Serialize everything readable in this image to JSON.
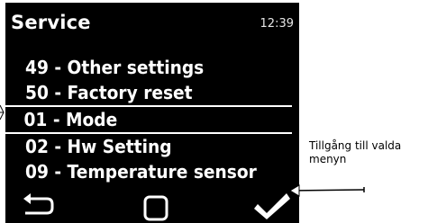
{
  "screen": {
    "title": "Service",
    "time": "12:39"
  },
  "menu": {
    "items": [
      {
        "label": "49 - Other settings",
        "selected": false
      },
      {
        "label": "50 - Factory reset",
        "selected": false
      },
      {
        "label": "01 - Mode",
        "selected": true
      },
      {
        "label": "02 - Hw Setting",
        "selected": false
      },
      {
        "label": "09 - Temperature sensor",
        "selected": false
      }
    ]
  },
  "softkeys": {
    "left_icon": "back-arrow-icon",
    "center_icon": "square-icon",
    "right_icon": "checkmark-icon"
  },
  "annotation": {
    "text_line1": "Tillgång till valda",
    "text_line2": "menyn"
  },
  "colors": {
    "screen_bg": "#000000",
    "screen_fg": "#ffffff",
    "page_bg": "#ffffff"
  }
}
